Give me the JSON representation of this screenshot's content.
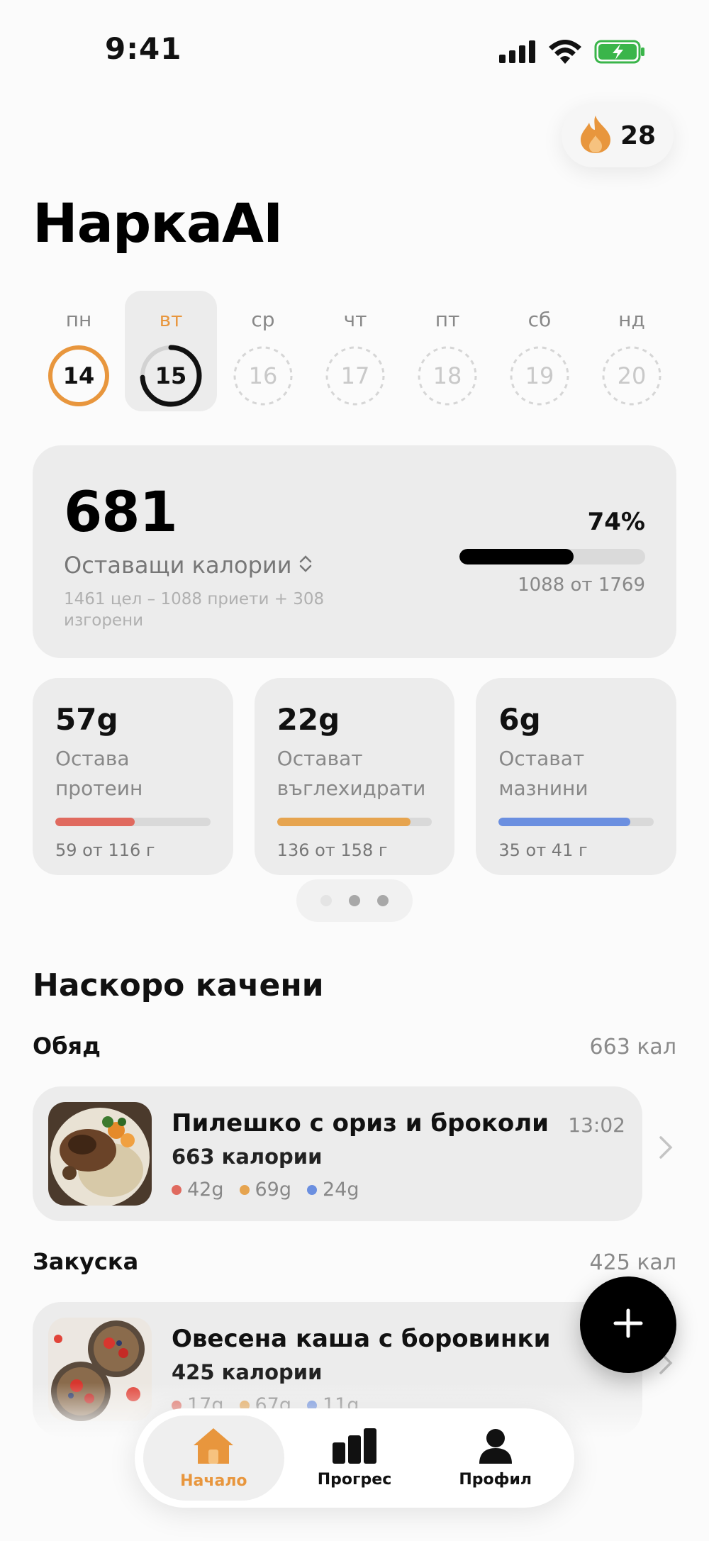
{
  "status_bar": {
    "time": "9:41"
  },
  "streak": {
    "count": "28",
    "icon": "flame-icon",
    "color": "#e8963d"
  },
  "app": {
    "title": "НаркаAI"
  },
  "week": {
    "days": [
      {
        "name": "пн",
        "num": "14",
        "state": "complete",
        "progress": 1.0
      },
      {
        "name": "вт",
        "num": "15",
        "state": "selected",
        "progress": 0.74
      },
      {
        "name": "ср",
        "num": "16",
        "state": "future",
        "progress": 0
      },
      {
        "name": "чт",
        "num": "17",
        "state": "future",
        "progress": 0
      },
      {
        "name": "пт",
        "num": "18",
        "state": "future",
        "progress": 0
      },
      {
        "name": "сб",
        "num": "19",
        "state": "future",
        "progress": 0
      },
      {
        "name": "нд",
        "num": "20",
        "state": "future",
        "progress": 0
      }
    ]
  },
  "calories": {
    "remaining": "681",
    "label": "Оставащи калории",
    "detail": "1461 цел – 1088 приети + 308 изгорени",
    "percent_text": "74%",
    "progress": 0.615,
    "of_text": "1088 от 1769"
  },
  "macros": [
    {
      "value": "57g",
      "label": "Остава протеин",
      "of_text": "59 от 116 г",
      "progress": 0.51,
      "color": "#e06a5f"
    },
    {
      "value": "22g",
      "label": "Остават въглехидрати",
      "of_text": "136 от 158 г",
      "progress": 0.86,
      "color": "#e6a44f"
    },
    {
      "value": "6g",
      "label": "Остават мазнини",
      "of_text": "35 от 41 г",
      "progress": 0.85,
      "color": "#6b8fe0"
    }
  ],
  "pager": {
    "count": 3,
    "active": 0
  },
  "recent": {
    "title": "Наскоро качени",
    "meals": [
      {
        "group": "Обяд",
        "group_cal": "663 кал",
        "title": "Пилешко с ориз и броколи",
        "time": "13:02",
        "kcal": "663 калории",
        "protein": "42g",
        "carbs": "69g",
        "fat": "24g"
      },
      {
        "group": "Закуска",
        "group_cal": "425 кал",
        "title": "Овесена каша с боровинки",
        "time": "",
        "kcal": "425 калории",
        "protein": "17g",
        "carbs": "67g",
        "fat": "11g"
      }
    ]
  },
  "tabbar": {
    "tabs": [
      {
        "label": "Начало",
        "icon": "home-icon",
        "active": true
      },
      {
        "label": "Прогрес",
        "icon": "bar-chart-icon",
        "active": false
      },
      {
        "label": "Профил",
        "icon": "profile-icon",
        "active": false
      }
    ]
  },
  "colors": {
    "accent": "#e8963d",
    "protein": "#e06a5f",
    "carbs": "#e6a44f",
    "fat": "#6b8fe0"
  }
}
